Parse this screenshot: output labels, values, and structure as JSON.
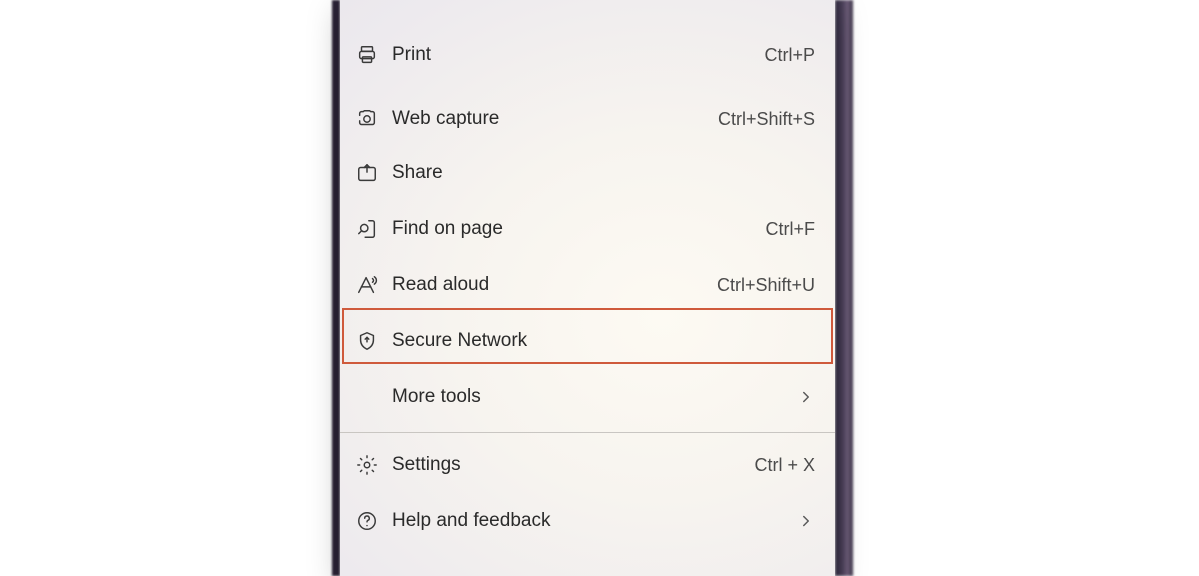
{
  "menu": {
    "items": [
      {
        "id": "print",
        "label": "Print",
        "shortcut": "Ctrl+P",
        "icon": "print-icon"
      },
      {
        "id": "webcapture",
        "label": "Web capture",
        "shortcut": "Ctrl+Shift+S",
        "icon": "web-capture-icon"
      },
      {
        "id": "share",
        "label": "Share",
        "shortcut": "",
        "icon": "share-icon"
      },
      {
        "id": "find",
        "label": "Find on page",
        "shortcut": "Ctrl+F",
        "icon": "find-icon"
      },
      {
        "id": "read",
        "label": "Read aloud",
        "shortcut": "Ctrl+Shift+U",
        "icon": "read-aloud-icon"
      },
      {
        "id": "secure",
        "label": "Secure Network",
        "shortcut": "",
        "icon": "shield-icon",
        "highlighted": true
      },
      {
        "id": "more",
        "label": "More tools",
        "shortcut": "",
        "submenu": true
      },
      {
        "id": "settings",
        "label": "Settings",
        "shortcut": "Ctrl + X",
        "icon": "gear-icon"
      },
      {
        "id": "help",
        "label": "Help and feedback",
        "shortcut": "",
        "icon": "help-icon",
        "submenu": true
      }
    ],
    "highlight_color": "#cf5a3c"
  }
}
